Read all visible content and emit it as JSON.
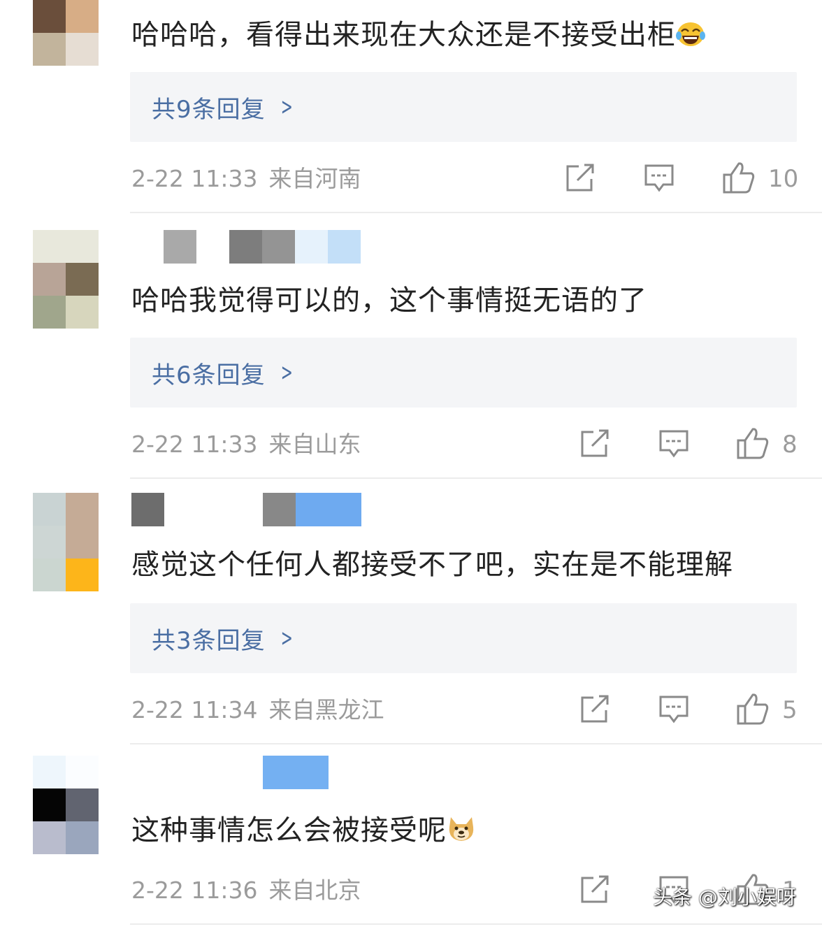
{
  "comments": [
    {
      "text": "哈哈哈，看得出来现在大众还是不接受出柜",
      "emoji": "laughing-crying-emoji",
      "reply_label": "共9条回复",
      "time": "2-22 11:33",
      "location": "来自河南",
      "likes": "10",
      "avatar_colors": [
        "#6a4e3b",
        "#d7ad86",
        "#c2b49c",
        "#e6ddd3"
      ]
    },
    {
      "text": "哈哈我觉得可以的，这个事情挺无语的了",
      "reply_label": "共6条回复",
      "time": "2-22 11:33",
      "location": "来自山东",
      "likes": "8",
      "avatar_colors": [
        "#e8e8dc",
        "#e8e8dc",
        "#b8a497",
        "#7a6b53",
        "#a0a68c",
        "#d7d6bd"
      ]
    },
    {
      "text": "感觉这个任何人都接受不了吧，实在是不能理解",
      "reply_label": "共3条回复",
      "time": "2-22 11:34",
      "location": "来自黑龙江",
      "likes": "5",
      "avatar_colors": [
        "#c9d3d3",
        "#c5ab96",
        "#cdd6d4",
        "#c5ab96",
        "#cbd6d0",
        "#fdb51a"
      ]
    },
    {
      "text": "这种事情怎么会被接受呢",
      "emoji": "doge-emoji",
      "time": "2-22 11:36",
      "location": "来自北京",
      "likes": "1",
      "avatar_colors": [
        "#eef6fc",
        "#fbfdff",
        "#050505",
        "#616470",
        "#b9bccd",
        "#9aa6bd"
      ]
    }
  ],
  "watermark": "头条 @刘小娱呀"
}
